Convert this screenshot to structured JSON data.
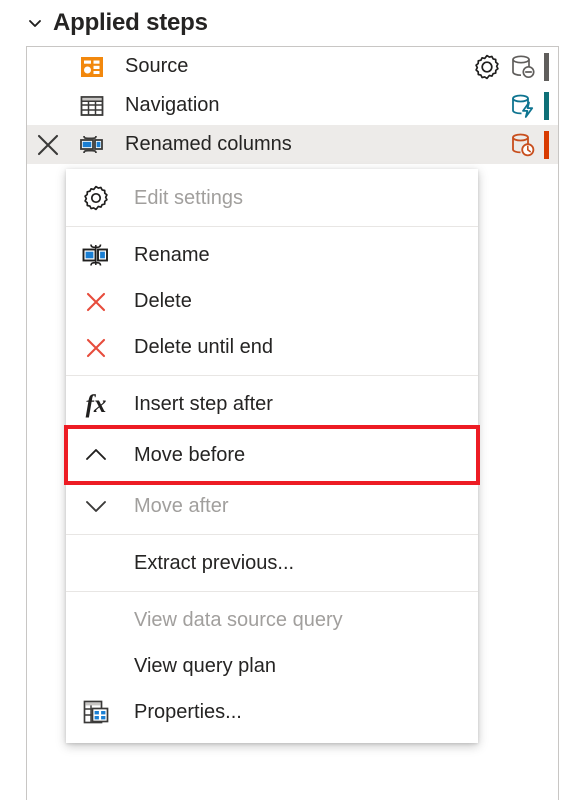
{
  "header": {
    "title": "Applied steps",
    "collapse_icon": "chevron-down-icon"
  },
  "steps": {
    "rows": [
      {
        "label": "Source",
        "icon": "source-step-icon",
        "selected": false,
        "has_delete": false,
        "has_gear": true,
        "db_icon": "database-disabled-icon",
        "db_color": "#605e5c",
        "status_color": "#605e5c"
      },
      {
        "label": "Navigation",
        "icon": "table-step-icon",
        "selected": false,
        "has_delete": false,
        "has_gear": false,
        "db_icon": "database-folding-icon",
        "db_color": "#0e7490",
        "status_color": "#0e7077"
      },
      {
        "label": "Renamed columns",
        "icon": "rename-columns-step-icon",
        "selected": true,
        "has_delete": true,
        "has_gear": false,
        "db_icon": "database-pending-icon",
        "db_color": "#c84e1d",
        "status_color": "#d83b01"
      }
    ]
  },
  "context_menu": {
    "items": [
      {
        "label": "Edit settings",
        "icon": "gear-icon",
        "disabled": true,
        "highlighted": false,
        "separator_after": true
      },
      {
        "label": "Rename",
        "icon": "rename-icon",
        "disabled": false,
        "highlighted": false,
        "separator_after": false
      },
      {
        "label": "Delete",
        "icon": "delete-x-icon",
        "disabled": false,
        "highlighted": false,
        "separator_after": false
      },
      {
        "label": "Delete until end",
        "icon": "delete-x-icon",
        "disabled": false,
        "highlighted": false,
        "separator_after": true
      },
      {
        "label": "Insert step after",
        "icon": "fx-icon",
        "disabled": false,
        "highlighted": false,
        "separator_after": false
      },
      {
        "label": "Move before",
        "icon": "chevron-up-icon",
        "disabled": false,
        "highlighted": true,
        "separator_after": false
      },
      {
        "label": "Move after",
        "icon": "chevron-down-icon",
        "disabled": true,
        "highlighted": false,
        "separator_after": true
      },
      {
        "label": "Extract previous...",
        "icon": "none",
        "disabled": false,
        "highlighted": false,
        "separator_after": true
      },
      {
        "label": "View data source query",
        "icon": "none",
        "disabled": true,
        "highlighted": false,
        "separator_after": false
      },
      {
        "label": "View query plan",
        "icon": "none",
        "disabled": false,
        "highlighted": false,
        "separator_after": false
      },
      {
        "label": "Properties...",
        "icon": "properties-icon",
        "disabled": false,
        "highlighted": false,
        "separator_after": false
      }
    ]
  },
  "colors": {
    "highlight_box": "#ed1c24",
    "source_icon": "#f2880d",
    "accent_blue": "#1a7fd4",
    "delete_red": "#e74c3c",
    "selected_row": "#edebe9",
    "panel_border": "#c8c6c4"
  }
}
